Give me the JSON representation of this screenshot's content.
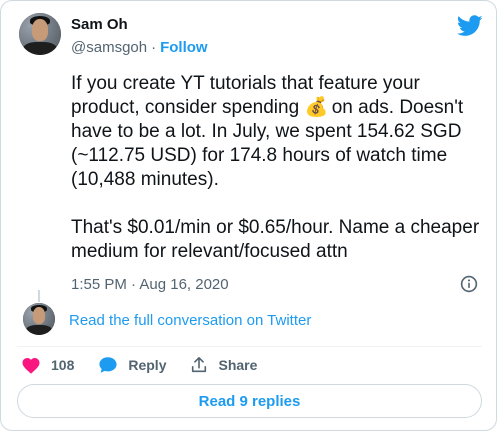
{
  "author": {
    "name": "Sam Oh",
    "handle": "@samsgoh",
    "separator": "·",
    "follow_label": "Follow"
  },
  "tweet": {
    "paragraph_1_before_emoji": "If you create YT tutorials that feature your product, consider spending ",
    "emoji": "💰",
    "paragraph_1_after_emoji": " on ads. Doesn't have to be a lot. In July, we spent 154.62 SGD (~112.75 USD) for 174.8 hours of watch time (10,488 minutes).",
    "paragraph_2": "That's $0.01/min or $0.65/hour. Name a cheaper medium for relevant/focused attn",
    "timestamp": "1:55 PM · Aug 16, 2020"
  },
  "conversation": {
    "link_text": "Read the full conversation on Twitter"
  },
  "actions": {
    "like_count": "108",
    "reply_label": "Reply",
    "share_label": "Share"
  },
  "read_replies_label": "Read 9 replies",
  "colors": {
    "accent": "#1d9bf0",
    "like": "#f91880",
    "muted": "#536471",
    "border": "#cfd9de"
  },
  "icons": {
    "brand": "twitter-bird-icon",
    "info": "info-icon",
    "like": "heart-icon",
    "reply": "speech-bubble-icon",
    "share": "share-icon"
  }
}
